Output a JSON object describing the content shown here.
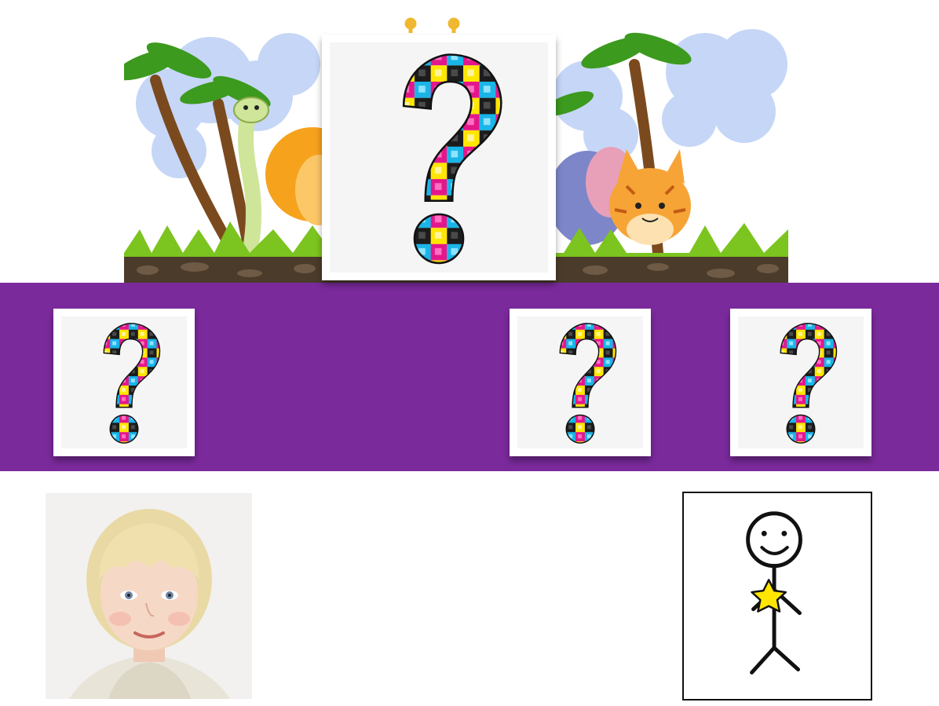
{
  "scene": {
    "banner": {
      "icon": "jungle-animals-illustration"
    },
    "purple_band": {
      "color": "#7b2a9c"
    },
    "mystery_cards": [
      {
        "icon": "question-mark-icon",
        "size": "large"
      },
      {
        "icon": "question-mark-icon",
        "size": "small"
      },
      {
        "icon": "question-mark-icon",
        "size": "small"
      },
      {
        "icon": "question-mark-icon",
        "size": "small"
      }
    ],
    "child_photo": {
      "icon": "child-portrait-photo"
    },
    "stick_figure": {
      "icon": "stick-figure-with-star-icon",
      "star_color": "#ffe600"
    }
  },
  "colors": {
    "cube_magenta": "#e3178c",
    "cube_cyan": "#19b5e8",
    "cube_yellow": "#ffe600",
    "cube_black": "#1c1c1c"
  }
}
